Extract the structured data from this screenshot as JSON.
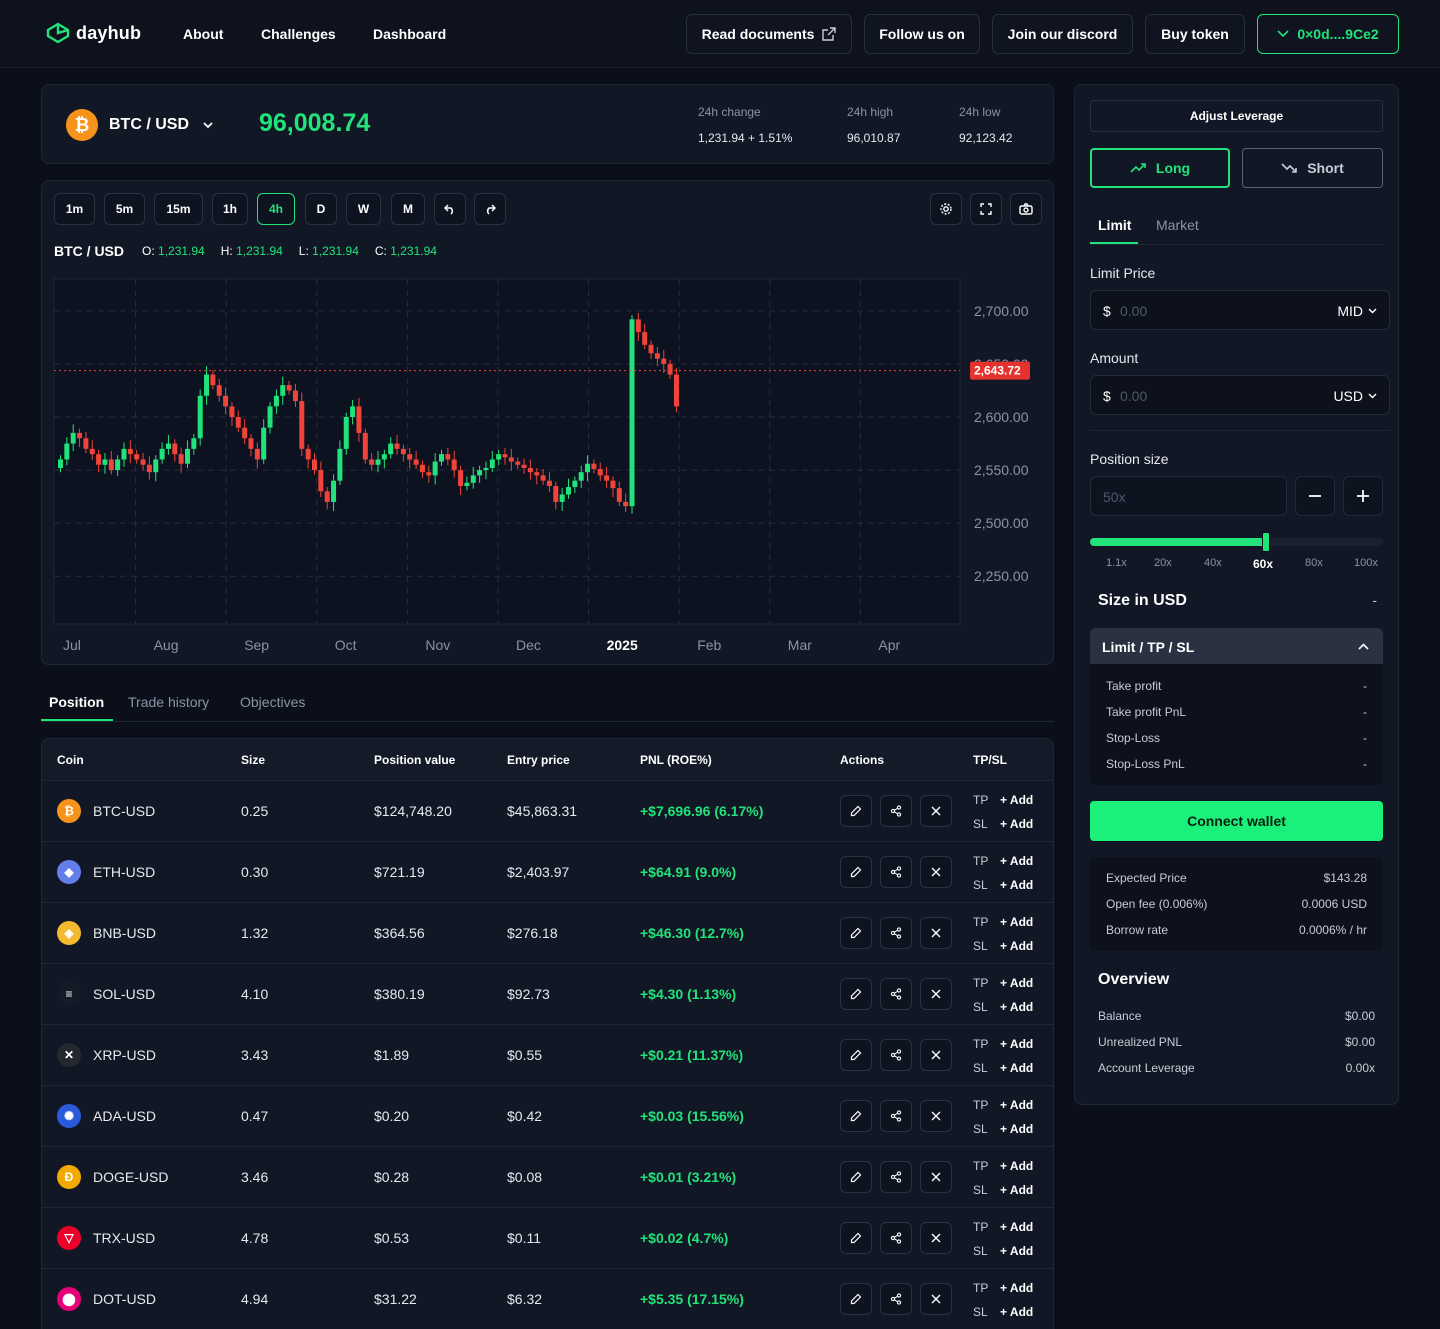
{
  "nav": {
    "brand": "dayhub",
    "links": [
      "About",
      "Challenges",
      "Dashboard"
    ],
    "buttons": [
      "Read documents",
      "Follow us on",
      "Join our discord",
      "Buy token"
    ],
    "wallet": "0×0d....9Ce2"
  },
  "ticker": {
    "pair": "BTC / USD",
    "price": "96,008.74",
    "change_label": "24h change",
    "change_value": "1,231.94 + 1.51%",
    "high_label": "24h high",
    "high_value": "96,010.87",
    "low_label": "24h low",
    "low_value": "92,123.42"
  },
  "chart": {
    "timeframes": [
      "1m",
      "5m",
      "15m",
      "1h",
      "4h",
      "D",
      "W",
      "M"
    ],
    "active_timeframe": "4h",
    "pair": "BTC / USD",
    "ohlc": [
      {
        "k": "O:",
        "v": "1,231.94"
      },
      {
        "k": "H:",
        "v": "1,231.94"
      },
      {
        "k": "L:",
        "v": "1,231.94"
      },
      {
        "k": "C:",
        "v": "1,231.94"
      }
    ],
    "current_price_label": "2,643.72"
  },
  "chart_data": {
    "type": "candlestick",
    "x_labels": [
      "Jul",
      "Aug",
      "Sep",
      "Oct",
      "Nov",
      "Dec",
      "2025",
      "Feb",
      "Mar",
      "Apr"
    ],
    "y_tick_labels": [
      "2,700.00",
      "2,650.00",
      "2,600.00",
      "2,550.00",
      "2,500.00",
      "2,250.00"
    ],
    "current_price": 2643.72,
    "close": [
      2560,
      2575,
      2585,
      2580,
      2570,
      2565,
      2555,
      2560,
      2550,
      2560,
      2570,
      2565,
      2560,
      2555,
      2548,
      2560,
      2570,
      2575,
      2565,
      2556,
      2570,
      2580,
      2620,
      2640,
      2630,
      2620,
      2610,
      2600,
      2590,
      2580,
      2570,
      2560,
      2590,
      2610,
      2620,
      2630,
      2625,
      2615,
      2570,
      2560,
      2550,
      2530,
      2520,
      2540,
      2570,
      2600,
      2610,
      2585,
      2560,
      2555,
      2560,
      2565,
      2575,
      2570,
      2565,
      2560,
      2555,
      2548,
      2545,
      2558,
      2565,
      2560,
      2550,
      2535,
      2538,
      2545,
      2550,
      2552,
      2560,
      2565,
      2562,
      2558,
      2555,
      2552,
      2548,
      2545,
      2540,
      2535,
      2520,
      2527,
      2534,
      2540,
      2548,
      2556,
      2551,
      2545,
      2540,
      2533,
      2520,
      2516,
      2692,
      2680,
      2668,
      2660,
      2655,
      2650,
      2640,
      2610
    ],
    "grid": true
  },
  "tabs": [
    "Position",
    "Trade history",
    "Objectives"
  ],
  "table": {
    "headers": [
      "Coin",
      "Size",
      "Position value",
      "Entry price",
      "PNL (ROE%)",
      "Actions",
      "TP/SL"
    ],
    "rows": [
      {
        "coin": "BTC-USD",
        "size": "0.25",
        "value": "$124,748.20",
        "entry": "$45,863.31",
        "pnl": "+$7,696.96 (6.17%)",
        "color": "#f7931a",
        "glyph": "₿"
      },
      {
        "coin": "ETH-USD",
        "size": "0.30",
        "value": "$721.19",
        "entry": "$2,403.97",
        "pnl": "+$64.91 (9.0%)",
        "color": "#627eea",
        "glyph": "◆"
      },
      {
        "coin": "BNB-USD",
        "size": "1.32",
        "value": "$364.56",
        "entry": "$276.18",
        "pnl": "+$46.30 (12.7%)",
        "color": "#f3ba2f",
        "glyph": "◈"
      },
      {
        "coin": "SOL-USD",
        "size": "4.10",
        "value": "$380.19",
        "entry": "$92.73",
        "pnl": "+$4.30 (1.13%)",
        "color": "#141a26",
        "glyph": "≡"
      },
      {
        "coin": "XRP-USD",
        "size": "3.43",
        "value": "$1.89",
        "entry": "$0.55",
        "pnl": "+$0.21 (11.37%)",
        "color": "#23292f",
        "glyph": "✕"
      },
      {
        "coin": "ADA-USD",
        "size": "0.47",
        "value": "$0.20",
        "entry": "$0.42",
        "pnl": "+$0.03 (15.56%)",
        "color": "#2a5ada",
        "glyph": "✺"
      },
      {
        "coin": "DOGE-USD",
        "size": "3.46",
        "value": "$0.28",
        "entry": "$0.08",
        "pnl": "+$0.01 (3.21%)",
        "color": "#f2a900",
        "glyph": "Ð"
      },
      {
        "coin": "TRX-USD",
        "size": "4.78",
        "value": "$0.53",
        "entry": "$0.11",
        "pnl": "+$0.02 (4.7%)",
        "color": "#eb0029",
        "glyph": "▽"
      },
      {
        "coin": "DOT-USD",
        "size": "4.94",
        "value": "$31.22",
        "entry": "$6.32",
        "pnl": "+$5.35 (17.15%)",
        "color": "#e6007a",
        "glyph": "⬤"
      }
    ],
    "tp_label": "TP",
    "sl_label": "SL",
    "add_label": "+ Add"
  },
  "side": {
    "adjust_leverage": "Adjust Leverage",
    "long": "Long",
    "short": "Short",
    "order_tabs": [
      "Limit",
      "Market"
    ],
    "limit_price_label": "Limit Price",
    "limit_price_placeholder": "0.00",
    "limit_price_suffix": "MID",
    "amount_label": "Amount",
    "amount_placeholder": "0.00",
    "amount_suffix": "USD",
    "currency_symbol": "$",
    "position_size_label": "Position size",
    "position_size_placeholder": "50x",
    "leverage_marks": [
      "1.1x",
      "20x",
      "40x",
      "60x",
      "80x",
      "100x"
    ],
    "leverage_selected": "60x",
    "leverage_fraction": 0.6,
    "size_in_usd_label": "Size in USD",
    "size_in_usd_value": "-",
    "tpsl_title": "Limit / TP / SL",
    "tpsl_rows": [
      {
        "k": "Take profit",
        "v": "-"
      },
      {
        "k": "Take profit PnL",
        "v": "-"
      },
      {
        "k": "Stop-Loss",
        "v": "-"
      },
      {
        "k": "Stop-Loss PnL",
        "v": "-"
      }
    ],
    "connect": "Connect wallet",
    "fees": [
      {
        "k": "Expected Price",
        "v": "$143.28"
      },
      {
        "k": "Open fee (0.006%)",
        "v": "0.0006 USD"
      },
      {
        "k": "Borrow rate",
        "v": "0.0006% / hr"
      }
    ],
    "overview_title": "Overview",
    "overview": [
      {
        "k": "Balance",
        "v": "$0.00"
      },
      {
        "k": "Unrealized PNL",
        "v": "$0.00"
      },
      {
        "k": "Account Leverage",
        "v": "0.00x"
      }
    ]
  },
  "colors": {
    "accent": "#22e37a",
    "up": "#22e37a",
    "down": "#f0433a",
    "bg": "#0b0f19",
    "panel": "#111725"
  }
}
